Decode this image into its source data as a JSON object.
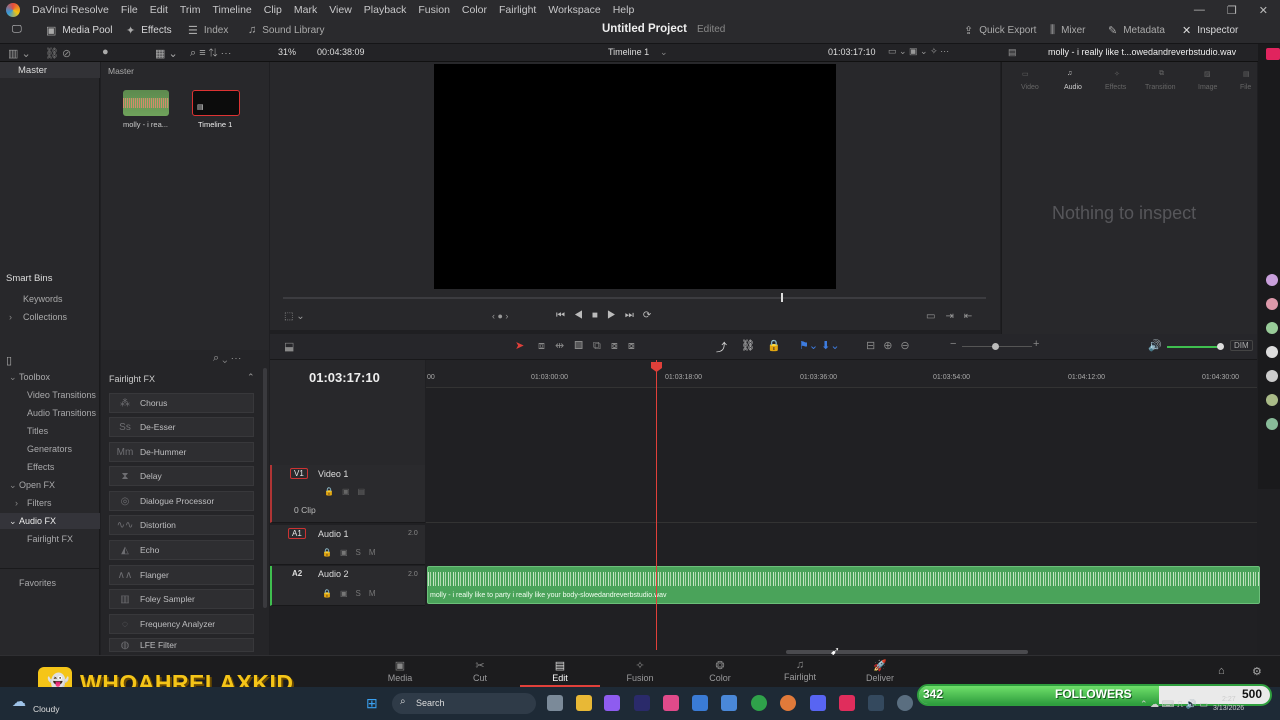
{
  "menu": [
    "DaVinci Resolve",
    "File",
    "Edit",
    "Trim",
    "Timeline",
    "Clip",
    "Mark",
    "View",
    "Playback",
    "Fusion",
    "Color",
    "Fairlight",
    "Workspace",
    "Help"
  ],
  "toolbar": {
    "media_pool": "Media Pool",
    "effects": "Effects",
    "index": "Index",
    "sound_library": "Sound Library",
    "project_title": "Untitled Project",
    "project_status": "Edited",
    "quick_export": "Quick Export",
    "mixer": "Mixer",
    "metadata": "Metadata",
    "inspector": "Inspector"
  },
  "subbar": {
    "zoom": "31%",
    "duration": "00:04:38:09",
    "timeline_name": "Timeline 1",
    "timecode": "01:03:17:10",
    "clip_name": "molly - i really like t...owedandreverbstudio.wav"
  },
  "bins": {
    "master": "Master",
    "smart_bins": "Smart Bins",
    "keywords": "Keywords",
    "collections": "Collections"
  },
  "pool": {
    "header": "Master",
    "clips": [
      {
        "label": "molly - i rea..."
      },
      {
        "label": "Timeline 1"
      }
    ]
  },
  "inspector": {
    "tabs": [
      "Video",
      "Audio",
      "Effects",
      "Transition",
      "Image",
      "File"
    ],
    "empty": "Nothing to inspect"
  },
  "toolbox": {
    "items": [
      "Toolbox",
      "Video Transitions",
      "Audio Transitions",
      "Titles",
      "Generators",
      "Effects",
      "Open FX",
      "Filters",
      "Audio FX",
      "Fairlight FX",
      "Favorites"
    ]
  },
  "fx": {
    "header": "Fairlight FX",
    "items": [
      "Chorus",
      "De-Esser",
      "De-Hummer",
      "Delay",
      "Dialogue Processor",
      "Distortion",
      "Echo",
      "Flanger",
      "Foley Sampler",
      "Frequency Analyzer",
      "LFE Filter"
    ]
  },
  "timeline": {
    "timecode": "01:03:17:10",
    "ruler": [
      "00",
      "01:03:00:00",
      "01:03:18:00",
      "01:03:36:00",
      "01:03:54:00",
      "01:04:12:00",
      "01:04:30:00"
    ],
    "dim": "DIM",
    "tracks": [
      {
        "tag": "V1",
        "name": "Video 1",
        "info": "0 Clip",
        "level": ""
      },
      {
        "tag": "A1",
        "name": "Audio 1",
        "info": "",
        "level": "2.0"
      },
      {
        "tag": "A2",
        "name": "Audio 2",
        "info": "",
        "level": "2.0"
      }
    ],
    "audio_clip_label": "molly - i really like to party i really like your body-slowedandreverbstudio.wav"
  },
  "pages": [
    "Media",
    "Cut",
    "Edit",
    "Fusion",
    "Color",
    "Fairlight",
    "Deliver"
  ],
  "overlay": {
    "brand": "WHOAHRELAXKID",
    "followers_count": "342",
    "followers_label": "FOLLOWERS",
    "followers_goal": "500",
    "followers_progress": 0.684,
    "weather": "Cloudy",
    "search": "Search",
    "time": "2:27",
    "date": "3/13/2026"
  },
  "colors": {
    "accent_red": "#e0403a",
    "clip_green": "#4aa35a",
    "bar_green": "#3fbf4f"
  }
}
